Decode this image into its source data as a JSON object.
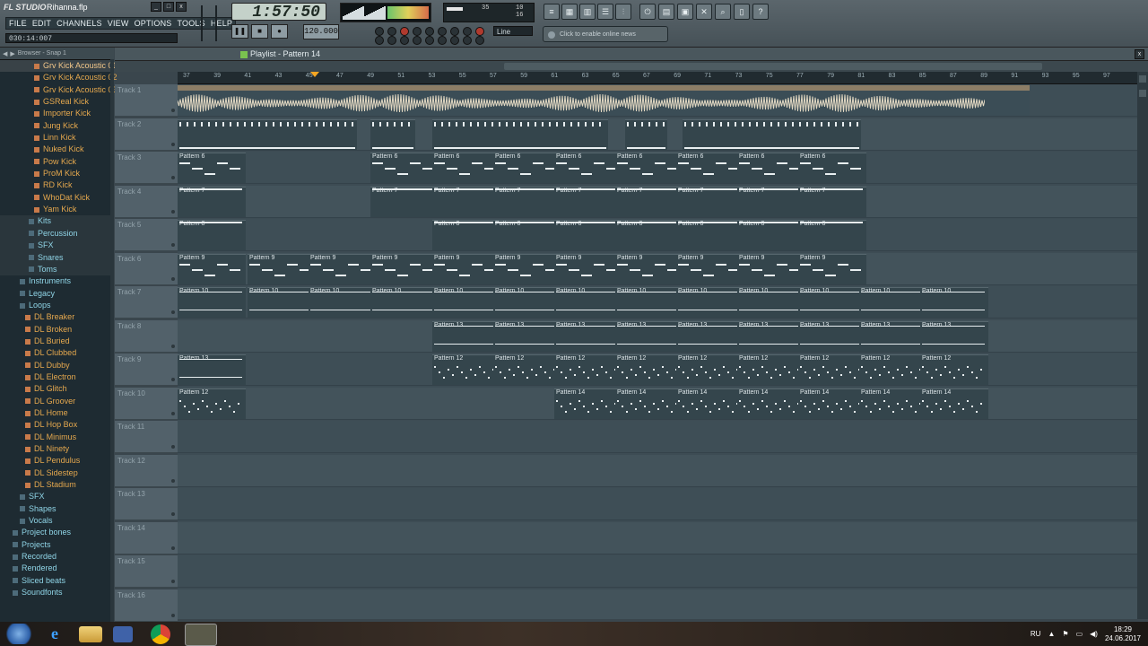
{
  "window": {
    "app": "FL STUDIO",
    "file": "Rihanna.flp"
  },
  "menu": [
    "FILE",
    "EDIT",
    "CHANNELS",
    "VIEW",
    "OPTIONS",
    "TOOLS",
    "HELP"
  ],
  "hint": "030:14:007",
  "time": "1:57:50",
  "tempo": "120.000",
  "cpu": {
    "a": "35",
    "b": "10",
    "c": "16"
  },
  "snap": "Line",
  "news": "Click to enable online news",
  "browser": {
    "header": "Browser - Snap 1",
    "items": [
      {
        "label": "Grv Kick Acoustic 01",
        "type": "file",
        "sel": true
      },
      {
        "label": "Grv Kick Acoustic 02",
        "type": "file"
      },
      {
        "label": "Grv Kick Acoustic 03",
        "type": "file"
      },
      {
        "label": "GSReal Kick",
        "type": "file"
      },
      {
        "label": "Importer Kick",
        "type": "file"
      },
      {
        "label": "Jung Kick",
        "type": "file"
      },
      {
        "label": "Linn Kick",
        "type": "file"
      },
      {
        "label": "Nuked Kick",
        "type": "file"
      },
      {
        "label": "Pow Kick",
        "type": "file"
      },
      {
        "label": "ProM Kick",
        "type": "file"
      },
      {
        "label": "RD Kick",
        "type": "file"
      },
      {
        "label": "WhoDat Kick",
        "type": "file"
      },
      {
        "label": "Yam Kick",
        "type": "file"
      },
      {
        "label": "Kits",
        "type": "folder",
        "indent": 2
      },
      {
        "label": "Percussion",
        "type": "folder",
        "indent": 2
      },
      {
        "label": "SFX",
        "type": "folder",
        "indent": 2
      },
      {
        "label": "Snares",
        "type": "folder",
        "indent": 2
      },
      {
        "label": "Toms",
        "type": "folder",
        "indent": 2
      },
      {
        "label": "Instruments",
        "type": "folder",
        "indent": 1
      },
      {
        "label": "Legacy",
        "type": "folder",
        "indent": 1
      },
      {
        "label": "Loops",
        "type": "folder",
        "indent": 1
      },
      {
        "label": "DL Breaker",
        "type": "file",
        "indent": 1
      },
      {
        "label": "DL Broken",
        "type": "file",
        "indent": 1
      },
      {
        "label": "DL Buried",
        "type": "file",
        "indent": 1
      },
      {
        "label": "DL Clubbed",
        "type": "file",
        "indent": 1
      },
      {
        "label": "DL Dubby",
        "type": "file",
        "indent": 1
      },
      {
        "label": "DL Electron",
        "type": "file",
        "indent": 1
      },
      {
        "label": "DL Glitch",
        "type": "file",
        "indent": 1
      },
      {
        "label": "DL Groover",
        "type": "file",
        "indent": 1
      },
      {
        "label": "DL Home",
        "type": "file",
        "indent": 1
      },
      {
        "label": "DL Hop Box",
        "type": "file",
        "indent": 1
      },
      {
        "label": "DL Minimus",
        "type": "file",
        "indent": 1
      },
      {
        "label": "DL Ninety",
        "type": "file",
        "indent": 1
      },
      {
        "label": "DL Pendulus",
        "type": "file",
        "indent": 1
      },
      {
        "label": "DL Sidestep",
        "type": "file",
        "indent": 1
      },
      {
        "label": "DL Stadium",
        "type": "file",
        "indent": 1
      },
      {
        "label": "SFX",
        "type": "folder",
        "indent": 1
      },
      {
        "label": "Shapes",
        "type": "folder",
        "indent": 1
      },
      {
        "label": "Vocals",
        "type": "folder",
        "indent": 1
      },
      {
        "label": "Project bones",
        "type": "folder",
        "indent": 0
      },
      {
        "label": "Projects",
        "type": "folder",
        "indent": 0
      },
      {
        "label": "Recorded",
        "type": "folder",
        "indent": 0
      },
      {
        "label": "Rendered",
        "type": "folder",
        "indent": 0
      },
      {
        "label": "Sliced beats",
        "type": "folder",
        "indent": 0
      },
      {
        "label": "Soundfonts",
        "type": "folder",
        "indent": 0
      }
    ]
  },
  "playlist": {
    "title": "Playlist - Pattern 14"
  },
  "ruler": [
    "37",
    "39",
    "41",
    "43",
    "45",
    "47",
    "49",
    "51",
    "53",
    "55",
    "57",
    "59",
    "61",
    "63",
    "65",
    "67",
    "69",
    "71",
    "73",
    "75",
    "77",
    "79",
    "81",
    "83",
    "85",
    "87",
    "89",
    "91",
    "93",
    "95",
    "97"
  ],
  "tracks": [
    "Track 1",
    "Track 2",
    "Track 3",
    "Track 4",
    "Track 5",
    "Track 6",
    "Track 7",
    "Track 8",
    "Track 9",
    "Track 10",
    "Track 11",
    "Track 12",
    "Track 13",
    "Track 14",
    "Track 15",
    "Track 16"
  ],
  "clips": [
    {
      "track": 2,
      "label": "",
      "bars": [
        [
          0,
          200
        ],
        [
          215,
          265
        ],
        [
          284,
          480
        ],
        [
          499,
          546
        ],
        [
          563,
          762
        ]
      ],
      "style": "ticks"
    },
    {
      "track": 3,
      "label": "Pattern 6",
      "starts": [
        0,
        215,
        284,
        352,
        420,
        488,
        556,
        624,
        692
      ],
      "width": 78,
      "style": "pattern"
    },
    {
      "track": 4,
      "label": "Pattern 7",
      "starts": [
        0,
        215,
        284,
        352,
        420,
        488,
        556,
        624,
        692
      ],
      "width": 78,
      "style": "flat"
    },
    {
      "track": 5,
      "label": "Pattern 8",
      "starts": [
        0,
        284,
        352,
        420,
        488,
        556,
        624,
        692
      ],
      "width": 78,
      "style": "flat"
    },
    {
      "track": 6,
      "label": "Pattern 9",
      "starts": [
        0,
        78,
        146,
        215,
        284,
        352,
        420,
        488,
        556,
        624,
        692
      ],
      "width": 78,
      "style": "pattern"
    },
    {
      "track": 7,
      "label": "Pattern 10",
      "starts": [
        0,
        78,
        146,
        215,
        284,
        352,
        420,
        488,
        556,
        624,
        692,
        760,
        828
      ],
      "width": 78,
      "style": "line"
    },
    {
      "track": 8,
      "label": "Pattern 13",
      "starts": [
        284,
        352,
        420,
        488,
        556,
        624,
        692,
        760,
        828
      ],
      "width": 78,
      "style": "line"
    },
    {
      "track": 9,
      "label": "Pattern 13",
      "starts": [
        0
      ],
      "width": 78,
      "style": "line"
    },
    {
      "track": 9,
      "label": "Pattern 12",
      "starts": [
        284,
        352,
        420,
        488,
        556,
        624,
        692,
        760,
        828
      ],
      "width": 78,
      "style": "dots"
    },
    {
      "track": 10,
      "label": "Pattern 12",
      "starts": [
        0
      ],
      "width": 78,
      "style": "dots"
    },
    {
      "track": 10,
      "label": "Pattern 14",
      "starts": [
        420,
        488,
        556,
        624,
        692,
        760,
        828
      ],
      "width": 78,
      "style": "dots"
    }
  ],
  "taskbar": {
    "lang": "RU",
    "time": "18:29",
    "date": "24.06.2017"
  }
}
